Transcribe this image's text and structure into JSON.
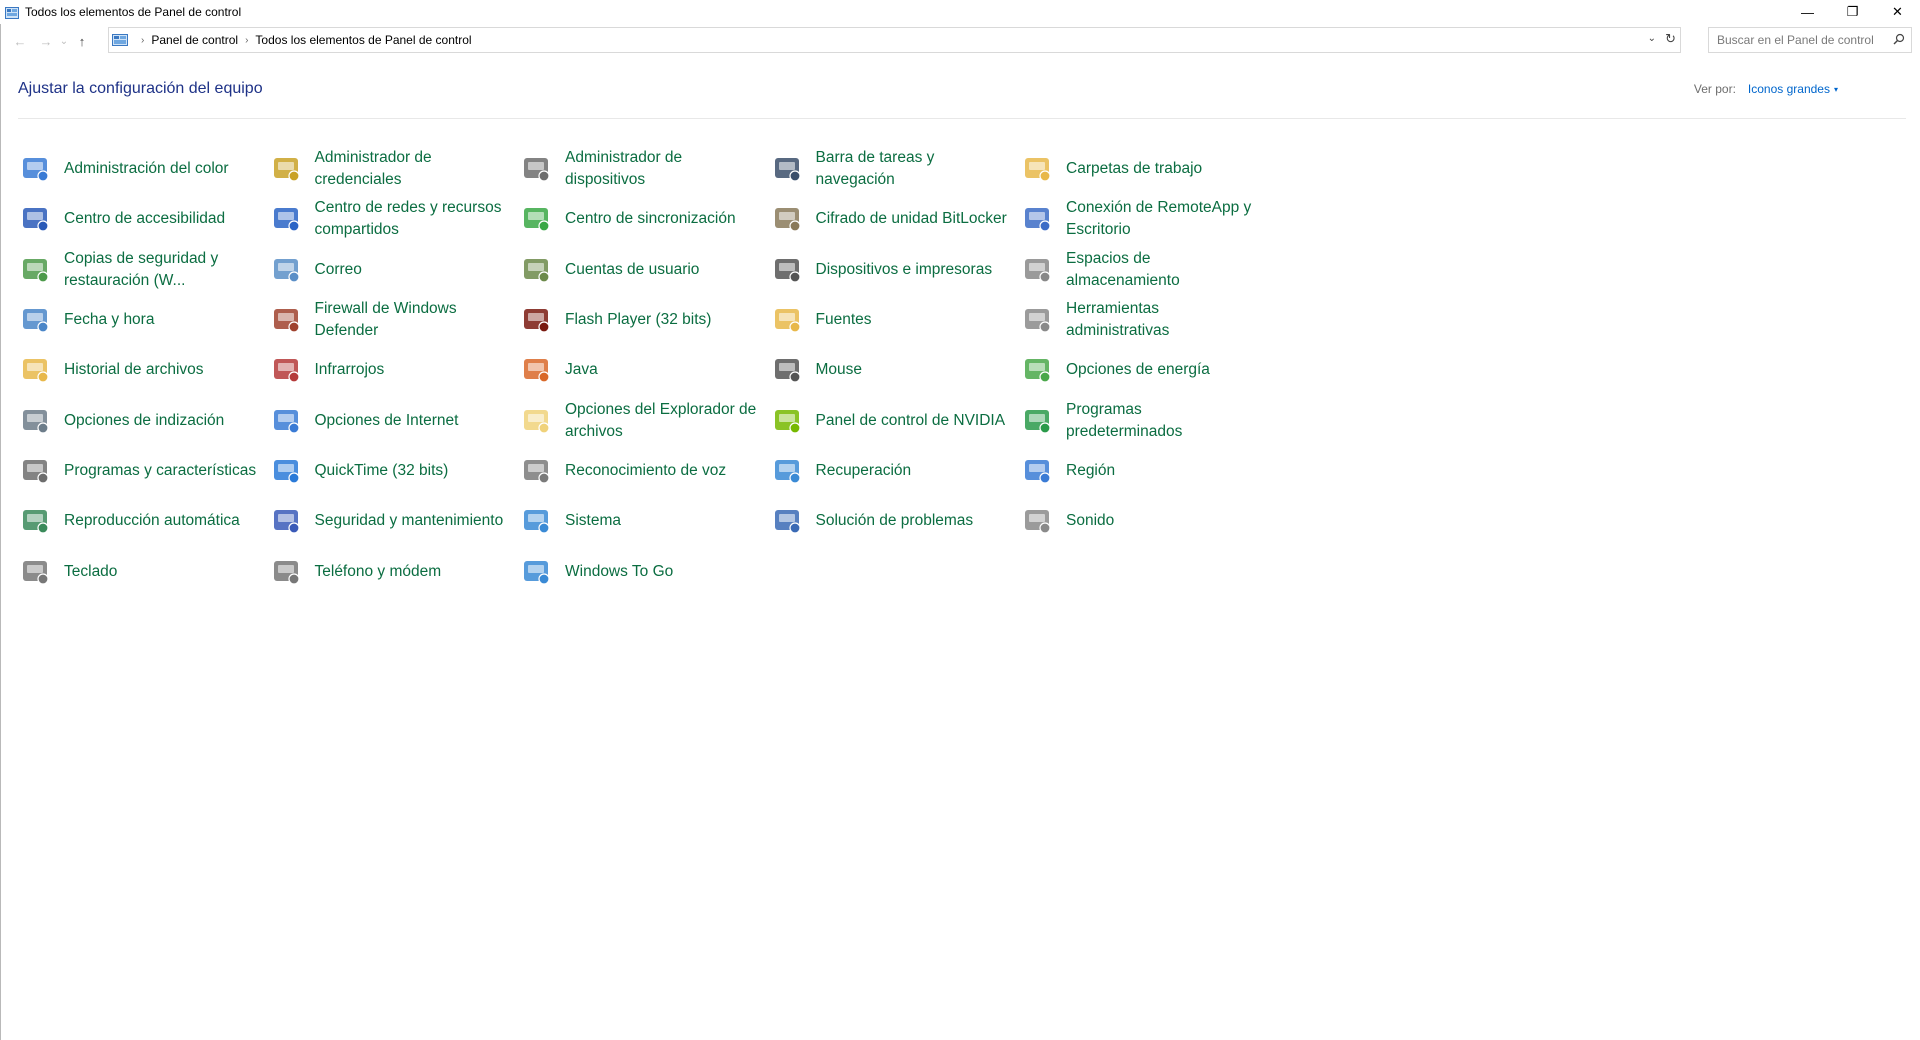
{
  "window": {
    "title": "Todos los elementos de Panel de control",
    "minimize": "—",
    "restore": "❐",
    "close": "✕"
  },
  "nav": {
    "back": "←",
    "forward": "→",
    "recent": "⌄",
    "up": "↑"
  },
  "address": {
    "breadcrumbs": [
      "Panel de control",
      "Todos los elementos de Panel de control"
    ],
    "separator": "›",
    "dropdown": "⌄",
    "refresh": "↻"
  },
  "search": {
    "placeholder": "Buscar en el Panel de control"
  },
  "header": {
    "title": "Ajustar la configuración del equipo",
    "viewby_label": "Ver por:",
    "viewby_value": "Iconos grandes",
    "viewby_caret": "▾"
  },
  "colors": {
    "link_green": "#0b6d41",
    "title_blue": "#1e3287",
    "accent_blue": "#0066cc"
  },
  "items": [
    {
      "label": "Administración del color",
      "icon": "color-management-icon",
      "c": "#3a7bd5"
    },
    {
      "label": "Administrador de credenciales",
      "icon": "credential-manager-icon",
      "c": "#c9a227"
    },
    {
      "label": "Administrador de dispositivos",
      "icon": "device-manager-icon",
      "c": "#6d6d6d"
    },
    {
      "label": "Barra de tareas y navegación",
      "icon": "taskbar-icon",
      "c": "#3b4f6b"
    },
    {
      "label": "Carpetas de trabajo",
      "icon": "work-folders-icon",
      "c": "#e8b84a"
    },
    {
      "label": "Centro de accesibilidad",
      "icon": "accessibility-icon",
      "c": "#2a5ab8"
    },
    {
      "label": "Centro de redes y recursos compartidos",
      "icon": "network-center-icon",
      "c": "#2a64c6"
    },
    {
      "label": "Centro de sincronización",
      "icon": "sync-center-icon",
      "c": "#39a845"
    },
    {
      "label": "Cifrado de unidad BitLocker",
      "icon": "bitlocker-icon",
      "c": "#8a7a5a"
    },
    {
      "label": "Conexión de RemoteApp y Escritorio",
      "icon": "remoteapp-icon",
      "c": "#3c6cc6"
    },
    {
      "label": "Copias de seguridad y restauración (W...",
      "icon": "backup-restore-icon",
      "c": "#4d9a4a"
    },
    {
      "label": "Correo",
      "icon": "mail-icon",
      "c": "#5b8fc7"
    },
    {
      "label": "Cuentas de usuario",
      "icon": "user-accounts-icon",
      "c": "#6c8a4a"
    },
    {
      "label": "Dispositivos e impresoras",
      "icon": "devices-printers-icon",
      "c": "#555555"
    },
    {
      "label": "Espacios de almacenamiento",
      "icon": "storage-spaces-icon",
      "c": "#888888"
    },
    {
      "label": "Fecha y hora",
      "icon": "date-time-icon",
      "c": "#4a86c8"
    },
    {
      "label": "Firewall de Windows Defender",
      "icon": "firewall-icon",
      "c": "#a0422e"
    },
    {
      "label": "Flash Player (32 bits)",
      "icon": "flash-player-icon",
      "c": "#7a1a10"
    },
    {
      "label": "Fuentes",
      "icon": "fonts-icon",
      "c": "#e8b84a"
    },
    {
      "label": "Herramientas administrativas",
      "icon": "admin-tools-icon",
      "c": "#8a8a8a"
    },
    {
      "label": "Historial de archivos",
      "icon": "file-history-icon",
      "c": "#e8b84a"
    },
    {
      "label": "Infrarrojos",
      "icon": "infrared-icon",
      "c": "#b53a3a"
    },
    {
      "label": "Java",
      "icon": "java-icon",
      "c": "#d9692a"
    },
    {
      "label": "Mouse",
      "icon": "mouse-icon",
      "c": "#555555"
    },
    {
      "label": "Opciones de energía",
      "icon": "power-options-icon",
      "c": "#4aa84a"
    },
    {
      "label": "Opciones de indización",
      "icon": "indexing-options-icon",
      "c": "#6d7d8a"
    },
    {
      "label": "Opciones de Internet",
      "icon": "internet-options-icon",
      "c": "#3a7bd5"
    },
    {
      "label": "Opciones del Explorador de archivos",
      "icon": "explorer-options-icon",
      "c": "#f0d27a"
    },
    {
      "label": "Panel de control de NVIDIA",
      "icon": "nvidia-icon",
      "c": "#76b900"
    },
    {
      "label": "Programas predeterminados",
      "icon": "default-programs-icon",
      "c": "#2a9a4a"
    },
    {
      "label": "Programas y características",
      "icon": "programs-features-icon",
      "c": "#6d6d6d"
    },
    {
      "label": "QuickTime (32 bits)",
      "icon": "quicktime-icon",
      "c": "#2a7ad8"
    },
    {
      "label": "Reconocimiento de voz",
      "icon": "speech-recognition-icon",
      "c": "#7a7a7a"
    },
    {
      "label": "Recuperación",
      "icon": "recovery-icon",
      "c": "#3a8ad5"
    },
    {
      "label": "Región",
      "icon": "region-icon",
      "c": "#3a7bd5"
    },
    {
      "label": "Reproducción automática",
      "icon": "autoplay-icon",
      "c": "#3a8a5a"
    },
    {
      "label": "Seguridad y mantenimiento",
      "icon": "security-maintenance-icon",
      "c": "#3a5ab8"
    },
    {
      "label": "Sistema",
      "icon": "system-icon",
      "c": "#3a8ad5"
    },
    {
      "label": "Solución de problemas",
      "icon": "troubleshooting-icon",
      "c": "#3a6ab5"
    },
    {
      "label": "Sonido",
      "icon": "sound-icon",
      "c": "#8a8a8a"
    },
    {
      "label": "Teclado",
      "icon": "keyboard-icon",
      "c": "#777777"
    },
    {
      "label": "Teléfono y módem",
      "icon": "phone-modem-icon",
      "c": "#777777"
    },
    {
      "label": "Windows To Go",
      "icon": "windows-to-go-icon",
      "c": "#3a8ad5"
    }
  ]
}
